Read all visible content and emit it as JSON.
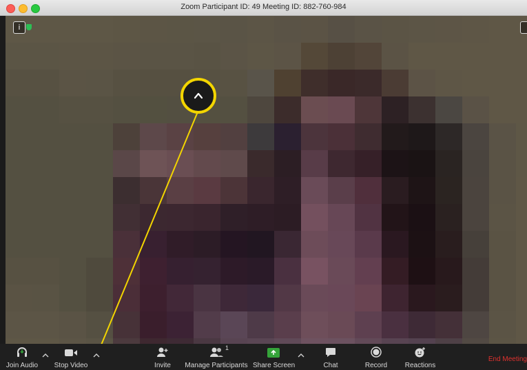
{
  "window": {
    "title": "Zoom Participant ID: 49   Meeting ID: 882-760-984"
  },
  "colors": {
    "callout": "#f3d500",
    "end_meeting": "#e0322f",
    "share_screen": "#35a43a",
    "secure_indicator": "#2dbf55"
  },
  "video": {
    "info_icon": "i",
    "mosaic": [
      [
        "#5e5746",
        "#5e5746",
        "#5e5746",
        "#5e5746",
        "#5d5645",
        "#5c5545",
        "#5b5545",
        "#5b5546",
        "#5a5446",
        "#5c5546",
        "#5a5346",
        "#5b5345",
        "#575045",
        "#5a5346",
        "#5b5445",
        "#5c5546",
        "#5d5546",
        "#5e5646",
        "#5f5746",
        "#5f5746"
      ],
      [
        "#5b5545",
        "#5b5545",
        "#5c5545",
        "#5c5545",
        "#5b5445",
        "#5a5445",
        "#5a5445",
        "#595344",
        "#5b5446",
        "#5d5646",
        "#5c5446",
        "#544838",
        "#4d4135",
        "#524539",
        "#5b5345",
        "#5f5746",
        "#5f5746",
        "#5f5746",
        "#5f5746",
        "#5f5746"
      ],
      [
        "#575142",
        "#575142",
        "#5b5445",
        "#5a5445",
        "#575142",
        "#565041",
        "#565041",
        "#575142",
        "#585243",
        "#59544a",
        "#4f4131",
        "#3f2e2b",
        "#3a2828",
        "#3b2a2a",
        "#4b3c34",
        "#5c5346",
        "#5e5646",
        "#5f5746",
        "#5f5746",
        "#5f5746"
      ],
      [
        "#545041",
        "#545041",
        "#565142",
        "#565142",
        "#545041",
        "#535040",
        "#534f41",
        "#545040",
        "#545041",
        "#4e473e",
        "#3c2c2b",
        "#6b4d51",
        "#6a4a52",
        "#4e3639",
        "#2d2124",
        "#3c3130",
        "#4b4742",
        "#5a5246",
        "#5f5746",
        "#5f5746"
      ],
      [
        "#545041",
        "#545041",
        "#545041",
        "#545041",
        "#4d413a",
        "#5d484a",
        "#5a4244",
        "#56403e",
        "#524040",
        "#3d3a3c",
        "#2b2030",
        "#4c343c",
        "#4b3038",
        "#3f2c30",
        "#221a1b",
        "#1e1819",
        "#2d2827",
        "#4b4540",
        "#5a5346",
        "#5e5746"
      ],
      [
        "#545041",
        "#545041",
        "#545041",
        "#545041",
        "#5a4748",
        "#6e5356",
        "#6a4e53",
        "#634a4d",
        "#5f4a4b",
        "#3a2a2c",
        "#2c1e24",
        "#583c48",
        "#3e2830",
        "#362028",
        "#1c1316",
        "#1a1314",
        "#2a2422",
        "#4a443e",
        "#5a5345",
        "#5e5746"
      ],
      [
        "#545041",
        "#545041",
        "#545041",
        "#545041",
        "#3c2e30",
        "#4a3538",
        "#5a3f44",
        "#5a3a41",
        "#4c3438",
        "#3a262e",
        "#2e1e26",
        "#6a4b58",
        "#5a3e4a",
        "#502f3c",
        "#2a1c20",
        "#1e1416",
        "#2b2421",
        "#4b443e",
        "#5a5345",
        "#5f5746"
      ],
      [
        "#545041",
        "#545041",
        "#545041",
        "#545041",
        "#412f34",
        "#3c2830",
        "#3c2730",
        "#3a252e",
        "#2f1f28",
        "#2e1d26",
        "#2c1c24",
        "#74505e",
        "#674756",
        "#513342",
        "#221418",
        "#1b1014",
        "#2a2120",
        "#4b443e",
        "#5b5445",
        "#5f5746"
      ],
      [
        "#545041",
        "#545041",
        "#545041",
        "#545041",
        "#4a3039",
        "#382030",
        "#301c28",
        "#2c1c26",
        "#241522",
        "#211621",
        "#3a2733",
        "#6d4c59",
        "#684858",
        "#5a3a4b",
        "#2a1820",
        "#1c1114",
        "#291d1e",
        "#46403a",
        "#5a5344",
        "#5f5746"
      ],
      [
        "#575142",
        "#575142",
        "#545041",
        "#4f4a3d",
        "#4e3038",
        "#3e2030",
        "#362030",
        "#352230",
        "#2d1a28",
        "#2a1a28",
        "#4a3040",
        "#785261",
        "#6a4a58",
        "#633f50",
        "#341c24",
        "#1e1014",
        "#28191c",
        "#443c38",
        "#5a5344",
        "#5f5746"
      ],
      [
        "#5a5344",
        "#595344",
        "#545041",
        "#4f4a3d",
        "#4b2e38",
        "#3d1f2e",
        "#422838",
        "#4a3442",
        "#3e2838",
        "#3a283a",
        "#523846",
        "#6a4a58",
        "#6a4858",
        "#6a4452",
        "#3e2430",
        "#2a181e",
        "#2a1c1e",
        "#443c38",
        "#5a5344",
        "#5f5746"
      ],
      [
        "#5c5546",
        "#5c5546",
        "#5a5345",
        "#555042",
        "#473238",
        "#3a1e2c",
        "#3c2234",
        "#523c4a",
        "#5a4656",
        "#4e3a48",
        "#5a3e4c",
        "#6e4e5a",
        "#6a4a56",
        "#5e4050",
        "#4a3040",
        "#3e2a36",
        "#443038",
        "#4e4642",
        "#5b5445",
        "#5f5746"
      ],
      [
        "#5e5746",
        "#5e5746",
        "#5c5546",
        "#5a5445",
        "#4c3a3e",
        "#3e2830",
        "#3e2a34",
        "#4a3842",
        "#584452",
        "#5a4654",
        "#604a58",
        "#6e5260",
        "#6c5260",
        "#624a58",
        "#584452",
        "#544250",
        "#4e4046",
        "#524a44",
        "#5c5545",
        "#5f5746"
      ]
    ]
  },
  "toolbar": {
    "join_audio": "Join Audio",
    "stop_video": "Stop Video",
    "invite": "Invite",
    "manage_participants": "Manage Participants",
    "participant_count": "1",
    "share_screen": "Share Screen",
    "chat": "Chat",
    "record": "Record",
    "reactions": "Reactions",
    "end_meeting": "End Meeting"
  }
}
